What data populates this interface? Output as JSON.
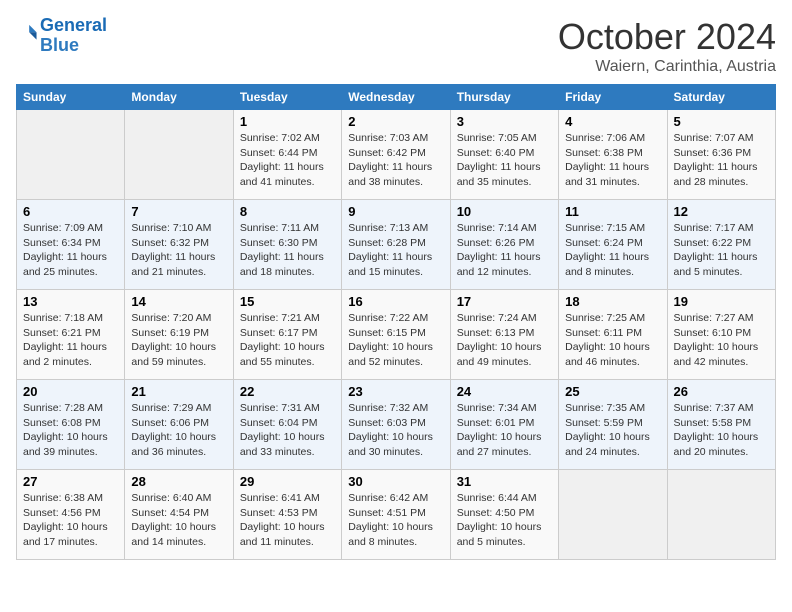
{
  "logo": {
    "line1": "General",
    "line2": "Blue"
  },
  "title": "October 2024",
  "subtitle": "Waiern, Carinthia, Austria",
  "days_of_week": [
    "Sunday",
    "Monday",
    "Tuesday",
    "Wednesday",
    "Thursday",
    "Friday",
    "Saturday"
  ],
  "weeks": [
    [
      {
        "day": "",
        "info": ""
      },
      {
        "day": "",
        "info": ""
      },
      {
        "day": "1",
        "info": "Sunrise: 7:02 AM\nSunset: 6:44 PM\nDaylight: 11 hours and 41 minutes."
      },
      {
        "day": "2",
        "info": "Sunrise: 7:03 AM\nSunset: 6:42 PM\nDaylight: 11 hours and 38 minutes."
      },
      {
        "day": "3",
        "info": "Sunrise: 7:05 AM\nSunset: 6:40 PM\nDaylight: 11 hours and 35 minutes."
      },
      {
        "day": "4",
        "info": "Sunrise: 7:06 AM\nSunset: 6:38 PM\nDaylight: 11 hours and 31 minutes."
      },
      {
        "day": "5",
        "info": "Sunrise: 7:07 AM\nSunset: 6:36 PM\nDaylight: 11 hours and 28 minutes."
      }
    ],
    [
      {
        "day": "6",
        "info": "Sunrise: 7:09 AM\nSunset: 6:34 PM\nDaylight: 11 hours and 25 minutes."
      },
      {
        "day": "7",
        "info": "Sunrise: 7:10 AM\nSunset: 6:32 PM\nDaylight: 11 hours and 21 minutes."
      },
      {
        "day": "8",
        "info": "Sunrise: 7:11 AM\nSunset: 6:30 PM\nDaylight: 11 hours and 18 minutes."
      },
      {
        "day": "9",
        "info": "Sunrise: 7:13 AM\nSunset: 6:28 PM\nDaylight: 11 hours and 15 minutes."
      },
      {
        "day": "10",
        "info": "Sunrise: 7:14 AM\nSunset: 6:26 PM\nDaylight: 11 hours and 12 minutes."
      },
      {
        "day": "11",
        "info": "Sunrise: 7:15 AM\nSunset: 6:24 PM\nDaylight: 11 hours and 8 minutes."
      },
      {
        "day": "12",
        "info": "Sunrise: 7:17 AM\nSunset: 6:22 PM\nDaylight: 11 hours and 5 minutes."
      }
    ],
    [
      {
        "day": "13",
        "info": "Sunrise: 7:18 AM\nSunset: 6:21 PM\nDaylight: 11 hours and 2 minutes."
      },
      {
        "day": "14",
        "info": "Sunrise: 7:20 AM\nSunset: 6:19 PM\nDaylight: 10 hours and 59 minutes."
      },
      {
        "day": "15",
        "info": "Sunrise: 7:21 AM\nSunset: 6:17 PM\nDaylight: 10 hours and 55 minutes."
      },
      {
        "day": "16",
        "info": "Sunrise: 7:22 AM\nSunset: 6:15 PM\nDaylight: 10 hours and 52 minutes."
      },
      {
        "day": "17",
        "info": "Sunrise: 7:24 AM\nSunset: 6:13 PM\nDaylight: 10 hours and 49 minutes."
      },
      {
        "day": "18",
        "info": "Sunrise: 7:25 AM\nSunset: 6:11 PM\nDaylight: 10 hours and 46 minutes."
      },
      {
        "day": "19",
        "info": "Sunrise: 7:27 AM\nSunset: 6:10 PM\nDaylight: 10 hours and 42 minutes."
      }
    ],
    [
      {
        "day": "20",
        "info": "Sunrise: 7:28 AM\nSunset: 6:08 PM\nDaylight: 10 hours and 39 minutes."
      },
      {
        "day": "21",
        "info": "Sunrise: 7:29 AM\nSunset: 6:06 PM\nDaylight: 10 hours and 36 minutes."
      },
      {
        "day": "22",
        "info": "Sunrise: 7:31 AM\nSunset: 6:04 PM\nDaylight: 10 hours and 33 minutes."
      },
      {
        "day": "23",
        "info": "Sunrise: 7:32 AM\nSunset: 6:03 PM\nDaylight: 10 hours and 30 minutes."
      },
      {
        "day": "24",
        "info": "Sunrise: 7:34 AM\nSunset: 6:01 PM\nDaylight: 10 hours and 27 minutes."
      },
      {
        "day": "25",
        "info": "Sunrise: 7:35 AM\nSunset: 5:59 PM\nDaylight: 10 hours and 24 minutes."
      },
      {
        "day": "26",
        "info": "Sunrise: 7:37 AM\nSunset: 5:58 PM\nDaylight: 10 hours and 20 minutes."
      }
    ],
    [
      {
        "day": "27",
        "info": "Sunrise: 6:38 AM\nSunset: 4:56 PM\nDaylight: 10 hours and 17 minutes."
      },
      {
        "day": "28",
        "info": "Sunrise: 6:40 AM\nSunset: 4:54 PM\nDaylight: 10 hours and 14 minutes."
      },
      {
        "day": "29",
        "info": "Sunrise: 6:41 AM\nSunset: 4:53 PM\nDaylight: 10 hours and 11 minutes."
      },
      {
        "day": "30",
        "info": "Sunrise: 6:42 AM\nSunset: 4:51 PM\nDaylight: 10 hours and 8 minutes."
      },
      {
        "day": "31",
        "info": "Sunrise: 6:44 AM\nSunset: 4:50 PM\nDaylight: 10 hours and 5 minutes."
      },
      {
        "day": "",
        "info": ""
      },
      {
        "day": "",
        "info": ""
      }
    ]
  ]
}
